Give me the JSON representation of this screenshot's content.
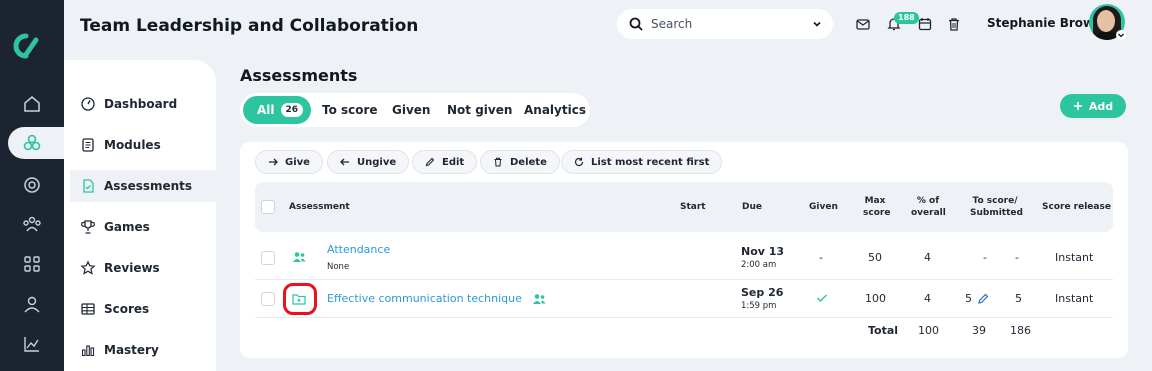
{
  "app": {
    "title": "Team Leadership and Collaboration"
  },
  "search": {
    "placeholder": "Search"
  },
  "header": {
    "notification_count": "188",
    "user_name": "Stephanie Brown"
  },
  "sidebar": {
    "items": [
      {
        "label": "Dashboard",
        "icon": "dashboard-icon"
      },
      {
        "label": "Modules",
        "icon": "modules-icon"
      },
      {
        "label": "Assessments",
        "icon": "assessments-icon",
        "active": true
      },
      {
        "label": "Games",
        "icon": "trophy-icon"
      },
      {
        "label": "Reviews",
        "icon": "star-icon"
      },
      {
        "label": "Scores",
        "icon": "table-icon"
      },
      {
        "label": "Mastery",
        "icon": "bar-chart-icon"
      }
    ]
  },
  "page": {
    "title": "Assessments"
  },
  "tabs": [
    {
      "label": "All",
      "count": "26",
      "active": true
    },
    {
      "label": "To score"
    },
    {
      "label": "Given"
    },
    {
      "label": "Not given"
    },
    {
      "label": "Analytics"
    }
  ],
  "add_button": "Add",
  "toolbar": {
    "give": "Give",
    "ungive": "Ungive",
    "edit": "Edit",
    "delete": "Delete",
    "sort": "List most recent first"
  },
  "table": {
    "headers": {
      "assessment": "Assessment",
      "start": "Start",
      "due": "Due",
      "given": "Given",
      "max_score_1": "Max",
      "max_score_2": "score",
      "pct_1": "% of",
      "pct_2": "overall",
      "to_score_1": "To score/",
      "to_score_2": "Submitted",
      "release": "Score release"
    },
    "rows": [
      {
        "name": "Attendance",
        "subtitle": "None",
        "due_date": "Nov 13",
        "due_time": "2:00 am",
        "given": "-",
        "max": "50",
        "pct": "4",
        "to_score": "-",
        "submitted": "-",
        "release": "Instant"
      },
      {
        "name": "Effective communication technique",
        "subtitle": "",
        "due_date": "Sep 26",
        "due_time": "1:59 pm",
        "given": "✓",
        "max": "100",
        "pct": "4",
        "to_score": "5",
        "submitted": "5",
        "release": "Instant"
      }
    ],
    "totals": {
      "label": "Total",
      "max": "100",
      "to_score": "39",
      "submitted": "186"
    }
  },
  "colors": {
    "accent": "#2cc5a0",
    "rail": "#1b2430",
    "link": "#2a9bd8",
    "highlight": "#e8121d"
  }
}
